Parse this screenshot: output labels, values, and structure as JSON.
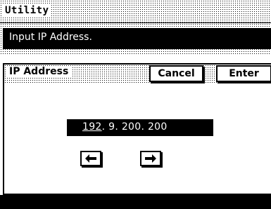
{
  "header": {
    "title": "Utility"
  },
  "message": {
    "text": "Input IP Address."
  },
  "panel": {
    "title": "IP Address",
    "cancel_label": "Cancel",
    "enter_label": "Enter"
  },
  "ip_input": {
    "active_octet": "192",
    "rest": ". 9. 200. 200"
  },
  "nav": {
    "left_icon": "left-arrow-icon",
    "right_icon": "right-arrow-icon"
  },
  "colors": {
    "background": "#ffffff",
    "foreground": "#000000"
  }
}
